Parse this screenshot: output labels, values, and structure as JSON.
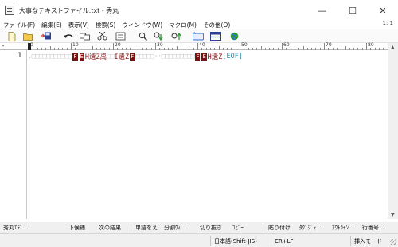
{
  "window": {
    "title": "大事なテキストファイル.txt - 秀丸",
    "minimize_glyph": "—",
    "maximize_glyph": "☐",
    "close_glyph": "✕"
  },
  "menu": {
    "items": [
      "ファイル(F)",
      "編集(E)",
      "表示(V)",
      "検索(S)",
      "ウィンドウ(W)",
      "マクロ(M)",
      "その他(O)"
    ],
    "position": "1: 1"
  },
  "toolbar": {
    "icons": [
      "new-file-icon",
      "open-folder-icon",
      "save-icon",
      "undo-icon",
      "cut-icon",
      "copy-icon",
      "paste-icon",
      "search-icon",
      "search-down-icon",
      "search-up-icon",
      "grep-icon",
      "window-split-icon",
      "web-icon"
    ],
    "colors": {
      "accent_blue": "#2f6fd6",
      "accent_green": "#2e9a3a"
    }
  },
  "ruler": {
    "left_arrow": "»",
    "labels": [
      "0",
      "10",
      "20",
      "30",
      "40",
      "50",
      "60",
      "70",
      "80"
    ]
  },
  "editor": {
    "line_number": "1",
    "segments": [
      {
        "type": "sp",
        "text": ".□□□□□□□□□□□"
      },
      {
        "type": "ctl",
        "text": "F"
      },
      {
        "type": "ctl",
        "text": "Ё"
      },
      {
        "type": "txt",
        "text": "H遺Z禹"
      },
      {
        "type": "sp",
        "text": "□□"
      },
      {
        "type": "txt",
        "text": "I遺Z"
      },
      {
        "type": "ctl",
        "text": "F"
      },
      {
        "type": "sp",
        "text": "□□□□□··□□□□□□□□□"
      },
      {
        "type": "ctl",
        "text": "F"
      },
      {
        "type": "ctl",
        "text": "Ё"
      },
      {
        "type": "txt",
        "text": "H遺Z"
      },
      {
        "type": "eof",
        "text": "[EOF]"
      }
    ],
    "colors": {
      "control_bg": "#7a1212",
      "text": "#8a1a1a",
      "eof": "#2a8aa0"
    }
  },
  "funcbar": {
    "keys": [
      "秀丸ｴﾃﾞ...",
      "下候補",
      "次の結果",
      "単語をえ...",
      "分割ｳｨ...",
      "切り抜き",
      "ｺﾋﾟｰ",
      "貼り付け",
      "ﾀｸﾞｼﾞｬ...",
      "ｱｳﾄﾗｲﾝ...",
      "行番号..."
    ]
  },
  "status": {
    "encoding": "日本語(Shift-JIS)",
    "newline": "CR+LF",
    "mode": "挿入モード"
  }
}
